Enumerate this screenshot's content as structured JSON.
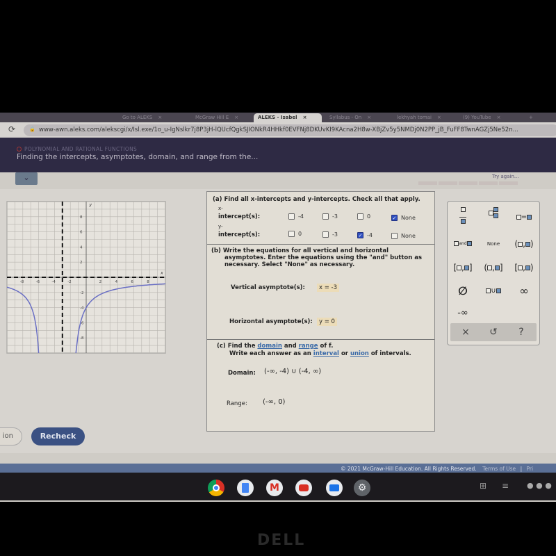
{
  "browser": {
    "tabs": [
      {
        "label": "Go to ALEKS",
        "active": false
      },
      {
        "label": "McGraw Hill E",
        "active": false
      },
      {
        "label": "ALEKS - Isabel",
        "active": true
      },
      {
        "label": "Syllabus - On",
        "active": false
      },
      {
        "label": "lekhyah tomai",
        "active": false
      },
      {
        "label": "(9) YouTube",
        "active": false
      }
    ],
    "close_glyph": "×",
    "new_tab_glyph": "+",
    "url": "www-awn.aleks.com/alekscgi/x/Isl.exe/1o_u-IgNslkr7j8P3jH-lQUcfQgkSJIONkR4HHkf0EVFNj8DKUvKI9KAcna2H8w-XBjZv5y5NMDj0N2PP_jB_FuFF8TwnAGZj5Ne52n...",
    "reload_glyph": "⟳",
    "lock_glyph": "🔒",
    "zoom_glyph": "⊕"
  },
  "header": {
    "topic": "POLYNOMIAL AND RATIONAL FUNCTIONS",
    "title": "Finding the intercepts, asymptotes, domain, and range from the...",
    "collapse_glyph": "⌄",
    "status_text": "Try again...",
    "progress_segments": 5
  },
  "graph": {
    "x_label": "x",
    "y_label": "y",
    "x_ticks": [
      "-8",
      "-6",
      "-4",
      "-2",
      "2",
      "4",
      "6",
      "8"
    ],
    "y_ticks": [
      "8",
      "6",
      "4",
      "2",
      "-2",
      "-4",
      "-6",
      "-8"
    ],
    "x_range": [
      -10,
      10
    ],
    "y_range": [
      -10,
      10
    ],
    "vertical_asymptote_x": -3,
    "horizontal_asymptote_y": 0,
    "curve_color": "#6a6fc4"
  },
  "part_a": {
    "prompt": "(a) Find all x-intercepts and y-intercepts. Check all that apply.",
    "x_label_top": "x-",
    "x_label": "intercept(s):",
    "x_options": [
      {
        "label": "-4",
        "checked": false
      },
      {
        "label": "-3",
        "checked": false
      },
      {
        "label": "0",
        "checked": false
      },
      {
        "label": "None",
        "checked": true
      }
    ],
    "y_label_top": "y-",
    "y_label": "intercept(s):",
    "y_options": [
      {
        "label": "0",
        "checked": false
      },
      {
        "label": "-3",
        "checked": false
      },
      {
        "label": "-4",
        "checked": true
      },
      {
        "label": "None",
        "checked": false
      }
    ],
    "check_glyph": "✓"
  },
  "part_b": {
    "prompt_line1": "(b) Write the equations for all vertical and horizontal",
    "prompt_line2": "asymptotes. Enter the equations using the \"and\" button as",
    "prompt_line3": "necessary. Select \"None\" as necessary.",
    "vertical_label": "Vertical asymptote(s):",
    "vertical_value": "x = -3",
    "horizontal_label": "Horizontal asymptote(s):",
    "horizontal_value": "y = 0"
  },
  "part_c": {
    "prompt_prefix": "(c) Find the ",
    "domain_link": "domain",
    "and": " and ",
    "range_link": "range",
    "prompt_suffix": " of f.",
    "line2_prefix": "Write each answer as an ",
    "interval_link": "interval",
    "or": " or ",
    "union_link": "union",
    "line2_suffix": " of intervals.",
    "domain_label": "Domain:",
    "domain_value": "(-∞, -4) ∪ (-4, ∞)",
    "range_label": "Range:",
    "range_value": "(-∞, 0)"
  },
  "keypad": {
    "keys": [
      {
        "name": "fraction",
        "label": ""
      },
      {
        "name": "mixed-number",
        "label": ""
      },
      {
        "name": "equals",
        "label": "="
      },
      {
        "name": "and",
        "label": "and"
      },
      {
        "name": "none",
        "label": "None"
      },
      {
        "name": "open-open-interval",
        "label": "( , )"
      },
      {
        "name": "closed-closed-interval",
        "label": "[ , ]"
      },
      {
        "name": "open-closed-interval",
        "label": "( , ]"
      },
      {
        "name": "closed-open-interval",
        "label": "[ , )"
      },
      {
        "name": "empty-set",
        "label": "∅"
      },
      {
        "name": "union",
        "label": "∪"
      },
      {
        "name": "infinity",
        "label": "∞"
      },
      {
        "name": "negative-infinity",
        "label": "-∞"
      }
    ],
    "clear_glyph": "×",
    "undo_glyph": "↺",
    "help_glyph": "?"
  },
  "actions": {
    "explanation_label": "ion",
    "recheck_label": "Recheck"
  },
  "footer": {
    "copyright": "© 2021 McGraw-Hill Education. All Rights Reserved.",
    "terms": "Terms of Use",
    "separator": "|",
    "privacy": "Pri"
  },
  "shelf": {
    "apps": [
      "chrome",
      "docs",
      "gmail",
      "youtube",
      "files",
      "settings"
    ]
  },
  "bezel": {
    "brand": "DELL"
  }
}
